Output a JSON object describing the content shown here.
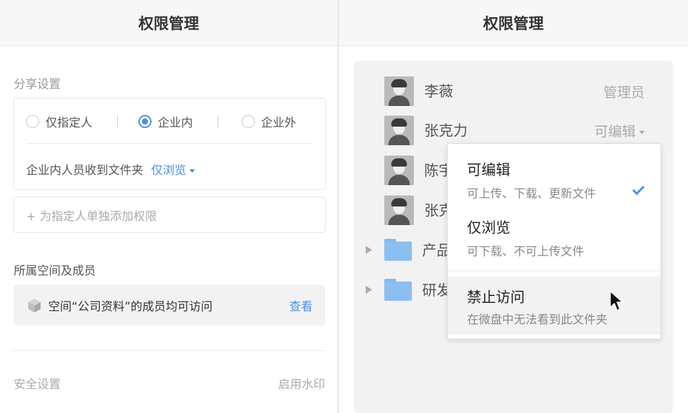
{
  "left": {
    "title": "权限管理",
    "share": {
      "label": "分享设置",
      "options": [
        "仅指定人",
        "企业内",
        "企业外"
      ],
      "selected": "企业内",
      "internal_text": "企业内人员收到文件夹",
      "internal_value": "仅浏览"
    },
    "add_person": "+ 为指定人单独添加权限",
    "space": {
      "label": "所属空间及成员",
      "text": "空间“公司资料”的成员均可访问",
      "view_link": "查看"
    },
    "security": {
      "label": "安全设置",
      "watermark": "启用水印"
    }
  },
  "right": {
    "title": "权限管理",
    "members": [
      {
        "name": "李薇",
        "role": "管理员"
      },
      {
        "name": "张克力",
        "role": "可编辑"
      },
      {
        "name": "陈宇",
        "role": ""
      },
      {
        "name": "张克",
        "role": ""
      }
    ],
    "groups": [
      {
        "name": "产品"
      },
      {
        "name": "研发"
      }
    ],
    "dropdown": {
      "options": [
        {
          "title": "可编辑",
          "desc": "可上传、下载、更新文件",
          "checked": true
        },
        {
          "title": "仅浏览",
          "desc": "可下载、不可上传文件",
          "checked": false
        },
        {
          "title": "禁止访问",
          "desc": "在微盘中无法看到此文件夹",
          "checked": false
        }
      ]
    }
  },
  "colors": {
    "accent": "#4a90e2",
    "folder": "#8cbef0",
    "header_bg": "#f7f7f7",
    "box_bg": "#f2f2f2"
  }
}
